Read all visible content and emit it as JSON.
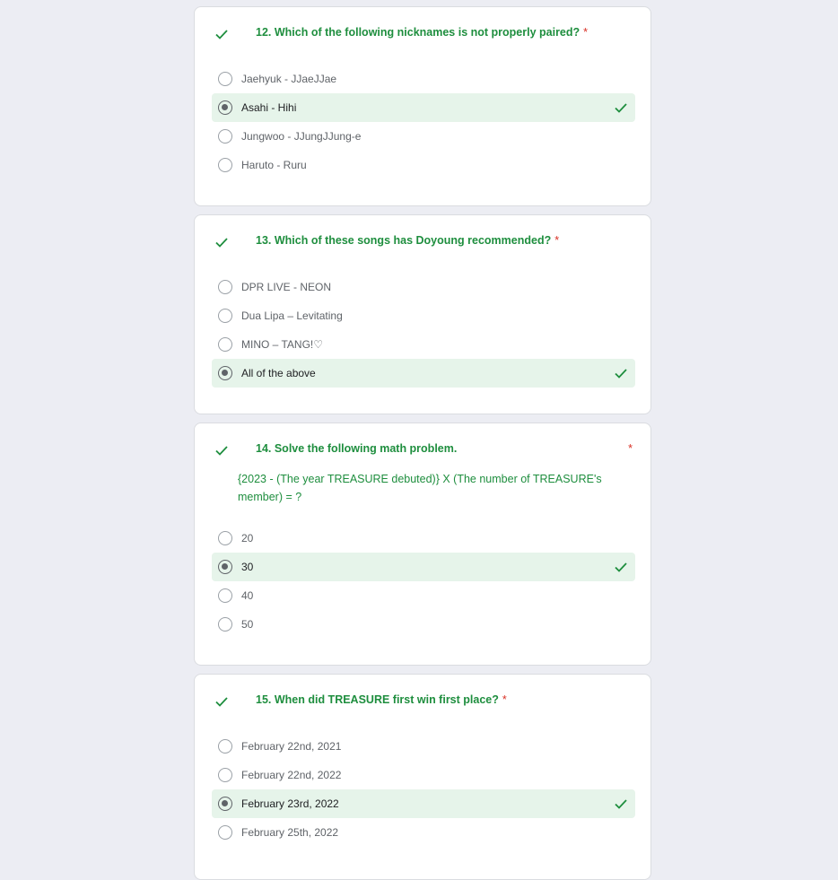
{
  "colors": {
    "correct": "#1e8e3e",
    "correct_bg": "#e6f4ea",
    "required": "#d93025",
    "page_bg": "#ecedf3"
  },
  "questions": [
    {
      "title": "12. Which of the following nicknames is not properly paired?",
      "required": "*",
      "status_icon": "check-icon",
      "options": [
        {
          "label": "Jaehyuk - JJaeJJae",
          "selected": false,
          "correct": false
        },
        {
          "label": "Asahi - Hihi",
          "selected": true,
          "correct": true
        },
        {
          "label": "Jungwoo - JJungJJung-e",
          "selected": false,
          "correct": false
        },
        {
          "label": "Haruto - Ruru",
          "selected": false,
          "correct": false
        }
      ]
    },
    {
      "title": "13. Which of these songs has Doyoung recommended?",
      "required": "*",
      "status_icon": "check-icon",
      "options": [
        {
          "label": "DPR LIVE - NEON",
          "selected": false,
          "correct": false
        },
        {
          "label": "Dua Lipa – Levitating",
          "selected": false,
          "correct": false
        },
        {
          "label": "MINO – TANG!♡",
          "selected": false,
          "correct": false
        },
        {
          "label": "All of the above",
          "selected": true,
          "correct": true
        }
      ]
    },
    {
      "title": "14.  Solve the following math problem.",
      "required": "*",
      "description": "{2023 - (The year TREASURE debuted)} X (The number of TREASURE's member) = ?",
      "status_icon": "check-icon",
      "options": [
        {
          "label": "20",
          "selected": false,
          "correct": false
        },
        {
          "label": "30",
          "selected": true,
          "correct": true
        },
        {
          "label": "40",
          "selected": false,
          "correct": false
        },
        {
          "label": "50",
          "selected": false,
          "correct": false
        }
      ]
    },
    {
      "title": "15. When did TREASURE first win first place?",
      "required": "*",
      "status_icon": "check-icon",
      "options": [
        {
          "label": "February 22nd, 2021",
          "selected": false,
          "correct": false
        },
        {
          "label": "February 22nd, 2022",
          "selected": false,
          "correct": false
        },
        {
          "label": "February 23rd, 2022",
          "selected": true,
          "correct": true
        },
        {
          "label": "February 25th, 2022",
          "selected": false,
          "correct": false
        }
      ]
    }
  ]
}
